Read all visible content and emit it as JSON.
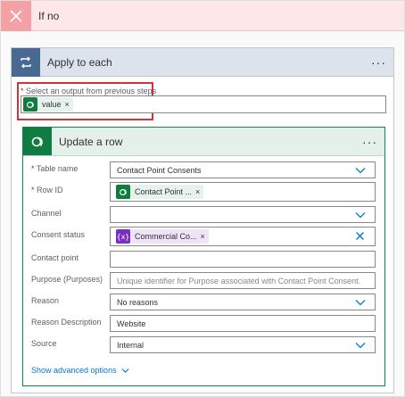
{
  "branch": {
    "label": "If no"
  },
  "apply_to_each": {
    "title": "Apply to each",
    "more": "···",
    "select_label": "Select an output from previous steps",
    "token": {
      "label": "value",
      "remove": "×"
    }
  },
  "update_row": {
    "title": "Update a row",
    "more": "···",
    "fields": {
      "table_name": {
        "label": "Table name",
        "value": "Contact Point Consents"
      },
      "row_id": {
        "label": "Row ID",
        "token": "Contact Point ...",
        "remove": "×"
      },
      "channel": {
        "label": "Channel",
        "value": ""
      },
      "consent_status": {
        "label": "Consent status",
        "token_icon": "{x}",
        "token": "Commercial Co...",
        "remove": "×"
      },
      "contact_point": {
        "label": "Contact point",
        "value": ""
      },
      "purpose": {
        "label": "Purpose (Purposes)",
        "placeholder": "Unique identifier for Purpose associated with Contact Point Consent."
      },
      "reason": {
        "label": "Reason",
        "value": "No reasons"
      },
      "reason_description": {
        "label": "Reason Description",
        "value": "Website"
      },
      "source": {
        "label": "Source",
        "value": "Internal"
      }
    },
    "advanced_link": "Show advanced options"
  },
  "colors": {
    "dataverse_green": "#107c41",
    "loop_blue": "#486991",
    "highlight_red": "#d13438",
    "link_blue": "#0078d4",
    "variable_purple": "#7b2ec4"
  },
  "icons": {
    "close": "close-icon",
    "loop": "loop-icon",
    "dataverse": "dataverse-icon",
    "chevron": "chevron-down-icon",
    "variable": "variable-icon"
  }
}
